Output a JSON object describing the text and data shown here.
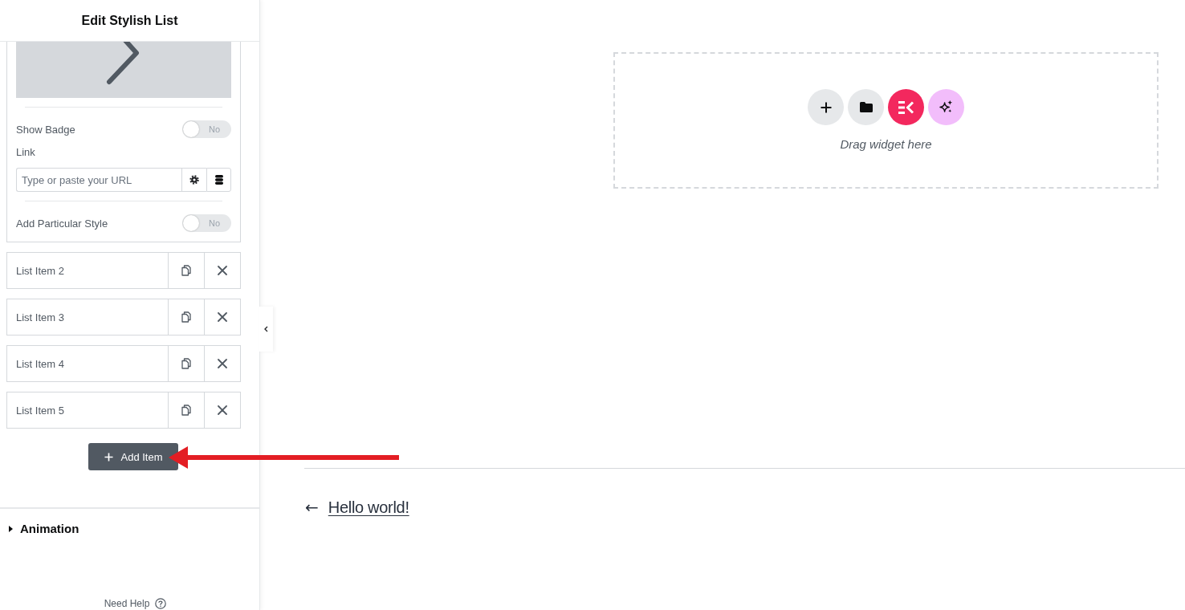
{
  "panel": {
    "title": "Edit Stylish List"
  },
  "item_editor": {
    "groups": [
      {
        "fields": [
          {
            "kind": "icon_preview"
          }
        ]
      },
      {
        "fields": [
          {
            "kind": "toggle",
            "label": "Show Badge",
            "on": false,
            "state_text": "No"
          },
          {
            "kind": "url",
            "label": "Link",
            "placeholder": "Type or paste your URL"
          }
        ]
      },
      {
        "fields": [
          {
            "kind": "toggle",
            "label": "Add Particular Style",
            "on": false,
            "state_text": "No"
          }
        ]
      }
    ]
  },
  "list_items": [
    {
      "label": "List Item 2"
    },
    {
      "label": "List Item 3"
    },
    {
      "label": "List Item 4"
    },
    {
      "label": "List Item 5"
    }
  ],
  "add_button": {
    "label": "Add Item"
  },
  "sections": [
    {
      "label": "Animation",
      "expanded": false
    }
  ],
  "help": {
    "label": "Need Help"
  },
  "canvas": {
    "drop_zone": {
      "buttons": [
        {
          "kind": "add"
        },
        {
          "kind": "folder"
        },
        {
          "kind": "logo"
        },
        {
          "kind": "sparkles"
        }
      ],
      "hint": "Drag widget here"
    },
    "post_nav": {
      "arrow": "←",
      "link": "Hello world!"
    }
  },
  "annotations": [
    {
      "kind": "arrow"
    }
  ]
}
